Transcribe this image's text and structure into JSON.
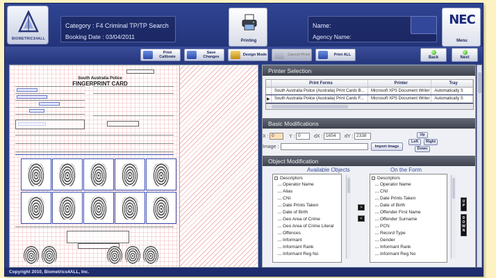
{
  "header": {
    "logo_text": "BIOMETRICS4ALL",
    "category": "Category : F4 Criminal TP/TP Search",
    "booking_date": "Booking Date : 03/04/2011",
    "print_label": "Printing",
    "name_label": "Name:",
    "agency_label": "Agency Name:",
    "nec_logo": "NEC",
    "menu_label": "Menu"
  },
  "toolbar": {
    "print_calibrate": "Print\nCalibrate",
    "save_changes": "Save\nChanges",
    "design_mode": "Design Mode",
    "cancel_print": "Cancel Print",
    "print_all": "Print ALL",
    "back": "Back",
    "next": "Next"
  },
  "document": {
    "card_title_line1": "South Australia Police",
    "card_title_line2": "FINGERPRINT CARD"
  },
  "printer_selection": {
    "title": "Printer Selection",
    "columns": [
      "Print Forms",
      "Printer",
      "Tray"
    ],
    "rows": [
      {
        "form": "South Australia Police (Australia) Print Cards B...",
        "printer": "Microsoft XPS Document Writer",
        "tray": "Automatically S"
      },
      {
        "form": "South Australia Police (Australia) Print Cards F...",
        "printer": "Microsoft XPS Document Writer",
        "tray": "Automatically S"
      }
    ],
    "selected_marker": "▶"
  },
  "basic_modifications": {
    "title": "Basic Modifications",
    "x_label": "X :",
    "x_value": "0",
    "y_label": "Y :",
    "y_value": "0",
    "dx_label": "dX :",
    "dx_value": "1654",
    "dy_label": "dY :",
    "dy_value": "2338",
    "image_label": "Image :",
    "image_value": "",
    "import_image": "Import Image",
    "up": "Up",
    "left": "Left",
    "right": "Right",
    "down": "Down"
  },
  "object_modification": {
    "title": "Object Modification",
    "available_title": "Available Objects",
    "form_title": "On the Form",
    "root": "Descriptors",
    "available": [
      "Operator Name",
      "Alias",
      "CNI",
      "Date Prints Taken",
      "Date of Birth",
      "Geo Area of Crime",
      "Geo Area of Crime Literal",
      "Offences",
      "Informant",
      "Informant Rank",
      "Informant Reg No"
    ],
    "on_form": [
      "Operator Name",
      "CNI",
      "Date Prints Taken",
      "Date of Birth",
      "Offender First Name",
      "Offender Surname",
      "PCN",
      "Record Type",
      "Gender",
      "Informant Rank",
      "Informant Reg No"
    ],
    "move_right": ">",
    "move_left": "<",
    "up_btn": "U\nP",
    "down_btn": "D\nO\nW\nN"
  },
  "footer": {
    "copyright": "Copyright 2010, Biometrics4ALL, Inc."
  },
  "colors": {
    "frame": "#2b3d86",
    "accent": "#1a2556",
    "section_header": "#4a4e5a",
    "background": "#fdf3c2"
  }
}
